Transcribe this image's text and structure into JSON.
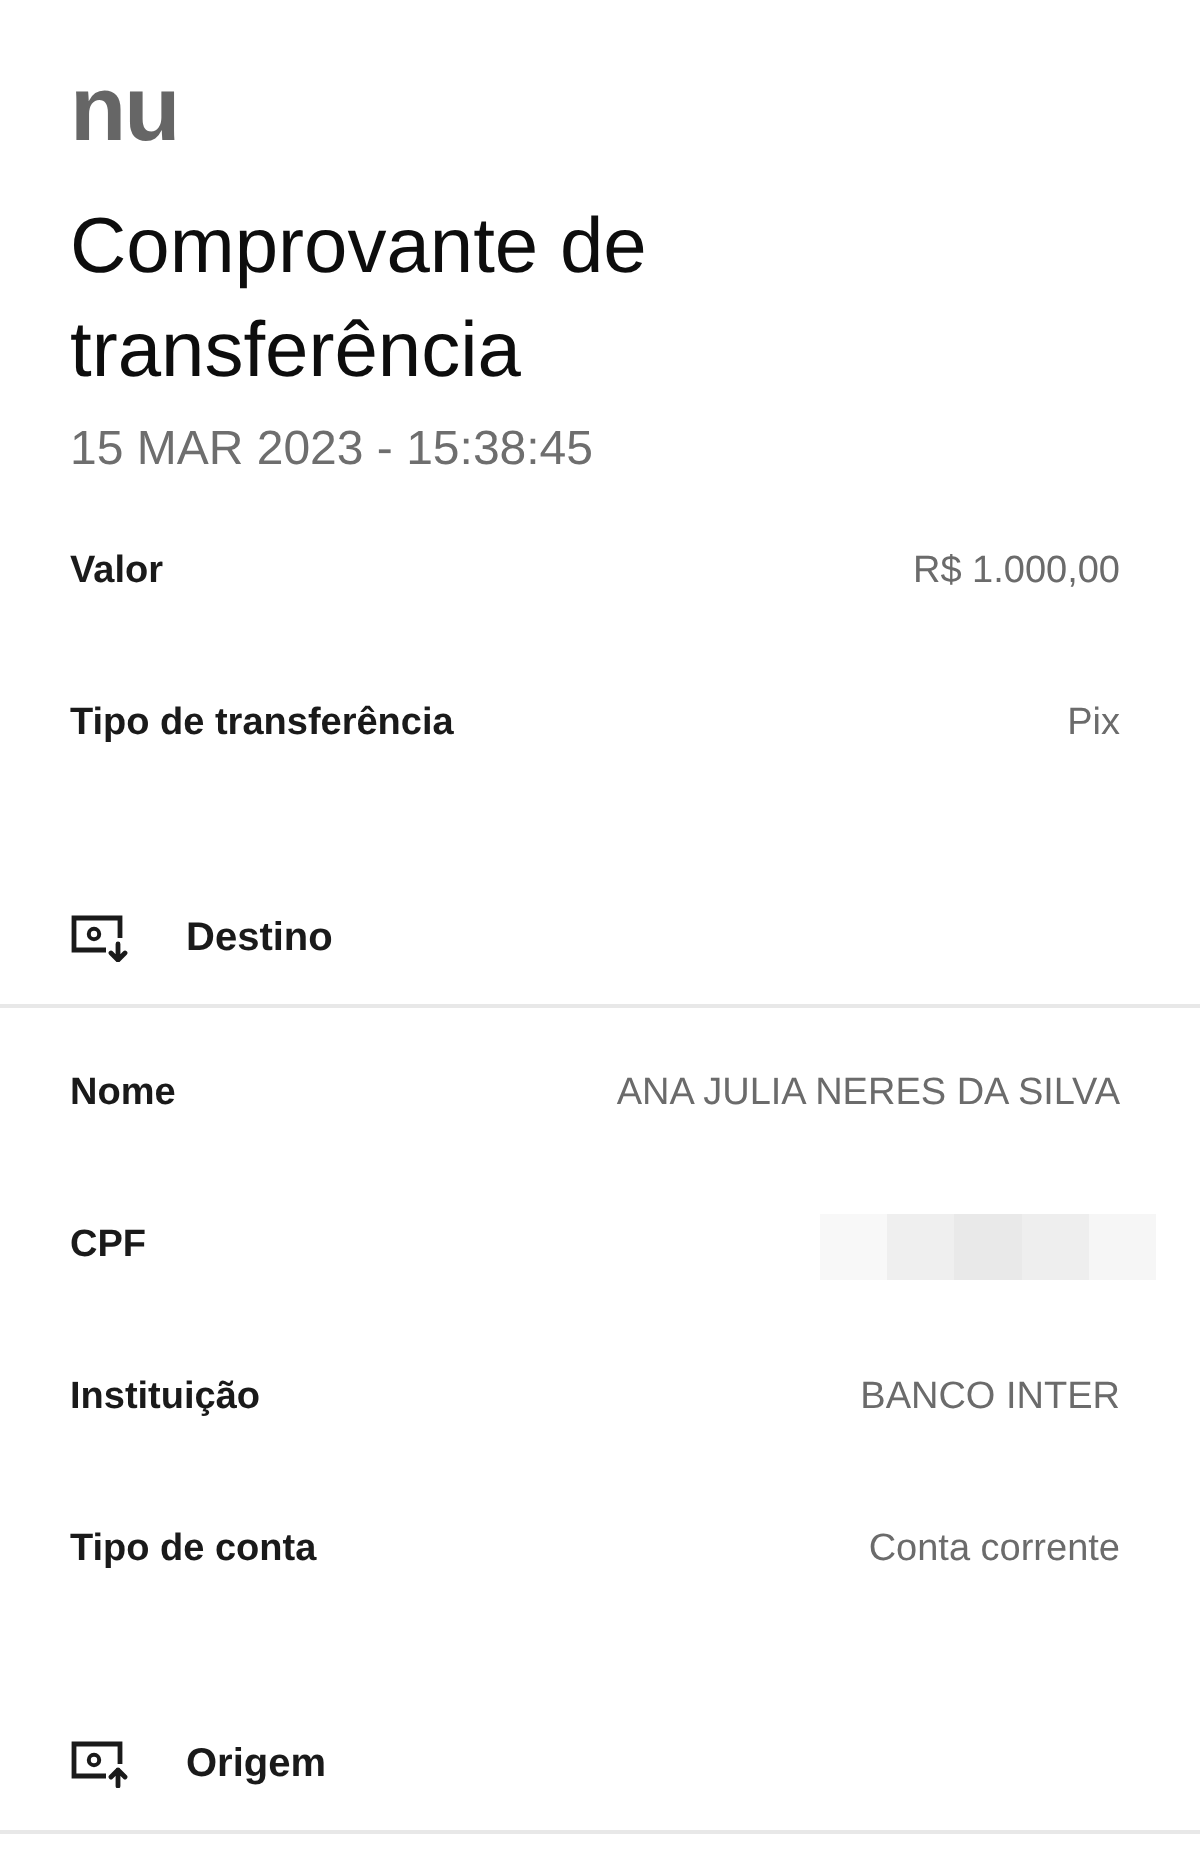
{
  "logo": "nu",
  "title": "Comprovante de transferência",
  "timestamp": "15 MAR 2023 - 15:38:45",
  "details": [
    {
      "label": "Valor",
      "value": "R$ 1.000,00"
    },
    {
      "label": "Tipo de transferência",
      "value": "Pix"
    }
  ],
  "sections": [
    {
      "kind": "destination",
      "title": "Destino",
      "rows": [
        {
          "kind": "text",
          "label": "Nome",
          "value": "ANA JULIA NERES DA SILVA"
        },
        {
          "kind": "redacted",
          "label": "CPF"
        },
        {
          "kind": "text",
          "label": "Instituição",
          "value": "BANCO INTER"
        },
        {
          "kind": "text",
          "label": "Tipo de conta",
          "value": "Conta corrente"
        }
      ]
    },
    {
      "kind": "origin",
      "title": "Origem"
    }
  ]
}
